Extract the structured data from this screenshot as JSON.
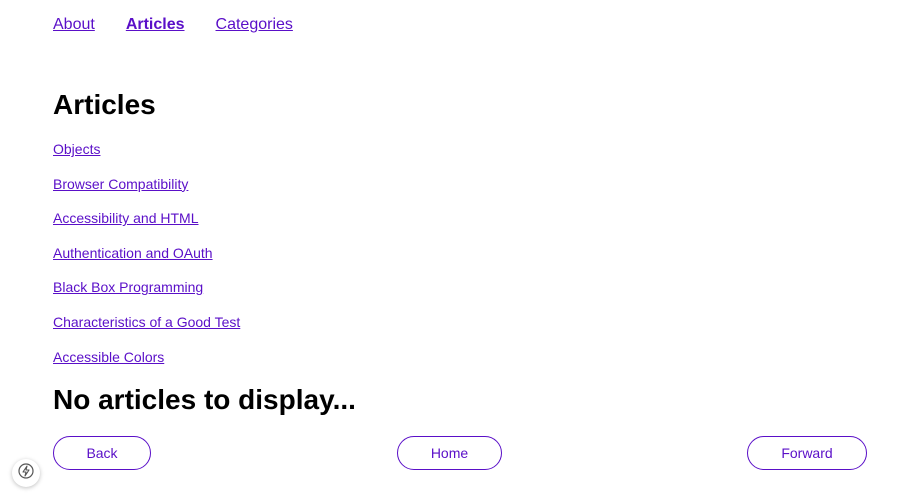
{
  "nav": {
    "items": [
      {
        "label": "About",
        "active": false
      },
      {
        "label": "Articles",
        "active": true
      },
      {
        "label": "Categories",
        "active": false
      }
    ]
  },
  "main": {
    "heading": "Articles",
    "articles": [
      "Objects",
      "Browser Compatibility",
      "Accessibility and HTML",
      "Authentication and OAuth",
      "Black Box Programming",
      "Characteristics of a Good Test",
      "Accessible Colors"
    ],
    "empty_message": "No articles to display..."
  },
  "pagination": {
    "back_label": "Back",
    "home_label": "Home",
    "forward_label": "Forward"
  },
  "badge": {
    "icon": "lightning-bolt-icon"
  },
  "colors": {
    "link": "#5a0fc8",
    "text": "#000000",
    "background": "#ffffff"
  }
}
